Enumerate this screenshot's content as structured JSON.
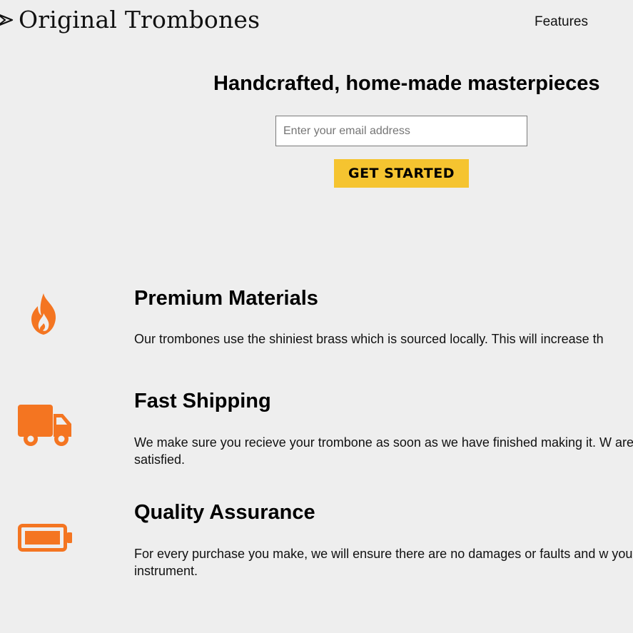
{
  "header": {
    "brand": "Original Trombones",
    "nav_features": "Features"
  },
  "hero": {
    "title": "Handcrafted, home-made masterpieces",
    "email_placeholder": "Enter your email address",
    "email_value": "",
    "cta_label": "GET STARTED"
  },
  "features": [
    {
      "icon": "fire-icon",
      "title": "Premium Materials",
      "text": "Our trombones use the shiniest brass which is sourced locally. This will increase th"
    },
    {
      "icon": "truck-icon",
      "title": "Fast Shipping",
      "text": "We make sure you recieve your trombone as soon as we have finished making it. W are not satisfied."
    },
    {
      "icon": "battery-icon",
      "title": "Quality Assurance",
      "text": "For every purchase you make, we will ensure there are no damages or faults and w your instrument."
    }
  ],
  "colors": {
    "background": "#eeeeee",
    "accent_orange": "#f47521",
    "cta_yellow": "#f5c430"
  }
}
